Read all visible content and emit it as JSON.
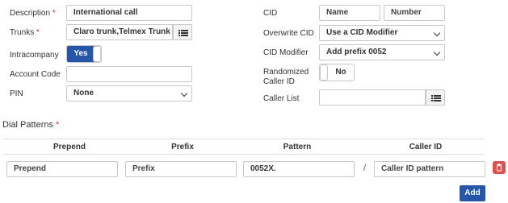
{
  "form": {
    "description": {
      "label": "Description",
      "required": "*",
      "value": "International call"
    },
    "trunks": {
      "label": "Trunks",
      "required": "*",
      "value": "Claro trunk,Telmex Trunk",
      "list_icon": "list-icon"
    },
    "intracompany": {
      "label": "Intracompany",
      "value": "Yes"
    },
    "account_code": {
      "label": "Account Code",
      "value": ""
    },
    "pin": {
      "label": "PIN",
      "value": "None"
    },
    "cid": {
      "label": "CID",
      "name_value": "Name",
      "number_value": "Number"
    },
    "overwrite_cid": {
      "label": "Overwrite CID",
      "value": "Use a CID Modifier"
    },
    "cid_modifier": {
      "label": "CID Modifier",
      "value": "Add prefix 0052"
    },
    "randomized_caller_id": {
      "label_line1": "Randomized",
      "label_line2": "Caller ID",
      "value": "No"
    },
    "caller_list": {
      "label": "Caller List",
      "value": "",
      "list_icon": "list-icon"
    }
  },
  "dial_patterns": {
    "title": "Dial Patterns",
    "required": "*",
    "columns": [
      "Prepend",
      "Prefix",
      "Pattern",
      "Caller ID"
    ],
    "row": {
      "prepend": "Prepend",
      "prefix": "Prefix",
      "pattern": "0052X.",
      "separator": "/",
      "caller_id": "Caller ID pattern",
      "delete_icon": "trash-icon"
    },
    "add_label": "Add"
  },
  "colors": {
    "accent": "#2556a8",
    "danger": "#d9534f",
    "required": "#c0392b"
  }
}
